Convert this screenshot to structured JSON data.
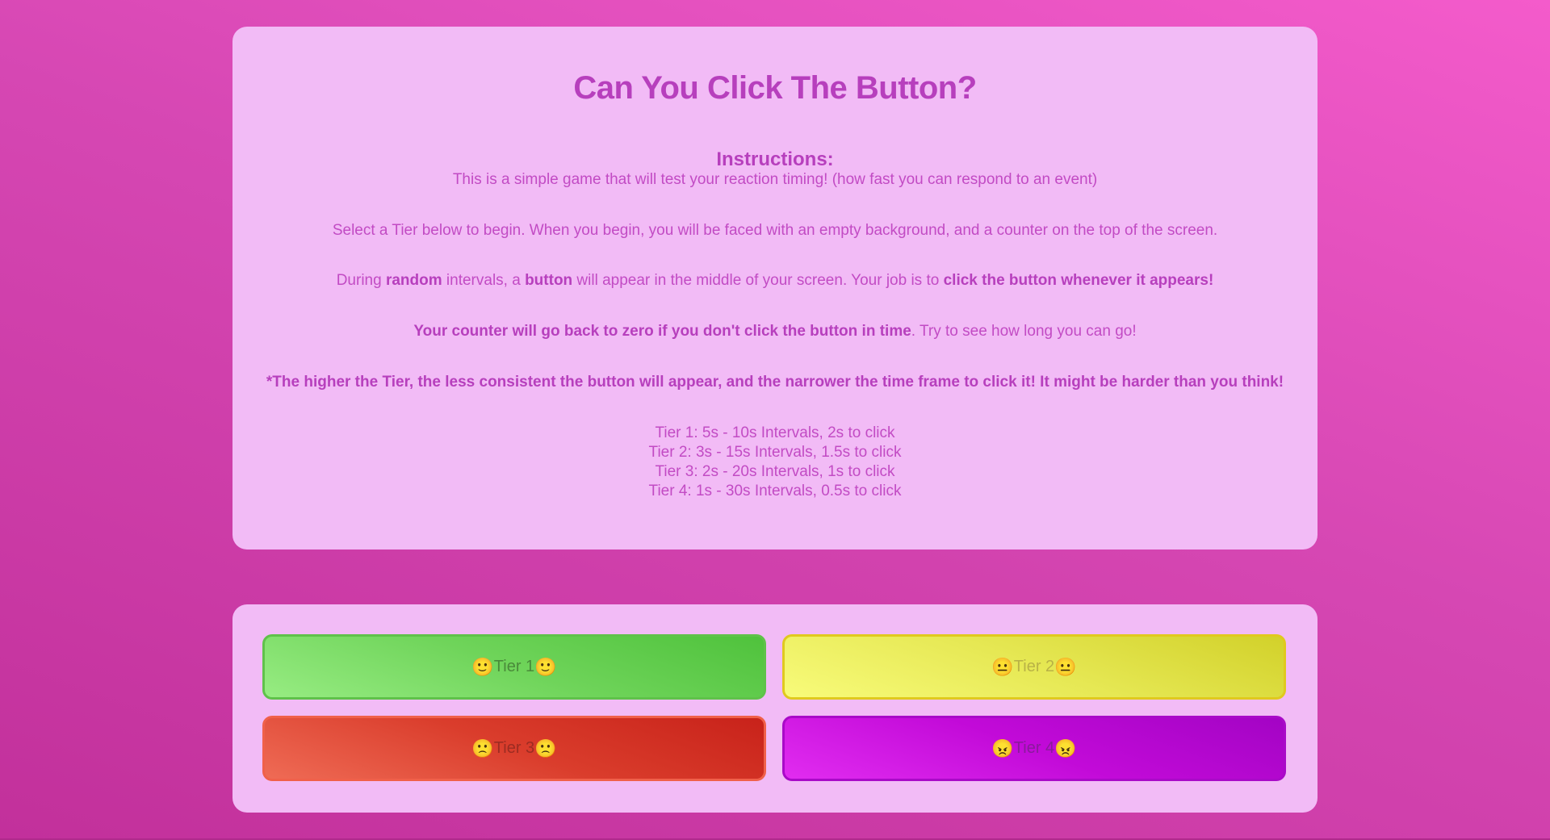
{
  "title": "Can You Click The Button?",
  "instructions": {
    "heading": "Instructions:",
    "intro": "This is a simple game that will test your reaction timing! (how fast you can respond to an event)",
    "select": "Select a Tier below to begin. When you begin, you will be faced with an empty background, and a counter on the top of the screen.",
    "during": {
      "t1": "During ",
      "b1": "random",
      "t2": " intervals, a ",
      "b2": "button",
      "t3": " will appear in the middle of your screen. Your job is to ",
      "b3": "click the button whenever it appears!"
    },
    "counter": {
      "b1": "Your counter will go back to zero if you don't click the button in time",
      "t1": ". Try to see how long you can go!"
    },
    "note": "*The higher the Tier, the less consistent the button will appear, and the narrower the time frame to click it! It might be harder than you think!",
    "tiers": [
      "Tier 1: 5s - 10s Intervals, 2s to click",
      "Tier 2: 3s - 15s Intervals, 1.5s to click",
      "Tier 3: 2s - 20s Intervals, 1s to click",
      "Tier 4: 1s - 30s Intervals, 0.5s to click"
    ]
  },
  "buttons": [
    {
      "label": "Tier 1",
      "emoji": "🙂",
      "icon": "slightly-smiling-face-icon",
      "color": "#6fd45a"
    },
    {
      "label": "Tier 2",
      "emoji": "😐",
      "icon": "neutral-face-icon",
      "color": "#e6e854"
    },
    {
      "label": "Tier 3",
      "emoji": "🙁",
      "icon": "slightly-frowning-face-icon",
      "color": "#da3d2c"
    },
    {
      "label": "Tier 4",
      "emoji": "😠",
      "icon": "angry-face-icon",
      "color": "#c20ad8"
    }
  ],
  "colors": {
    "background": "#d647b3",
    "card": "#f2bbf6",
    "text": "#c24bc4"
  }
}
